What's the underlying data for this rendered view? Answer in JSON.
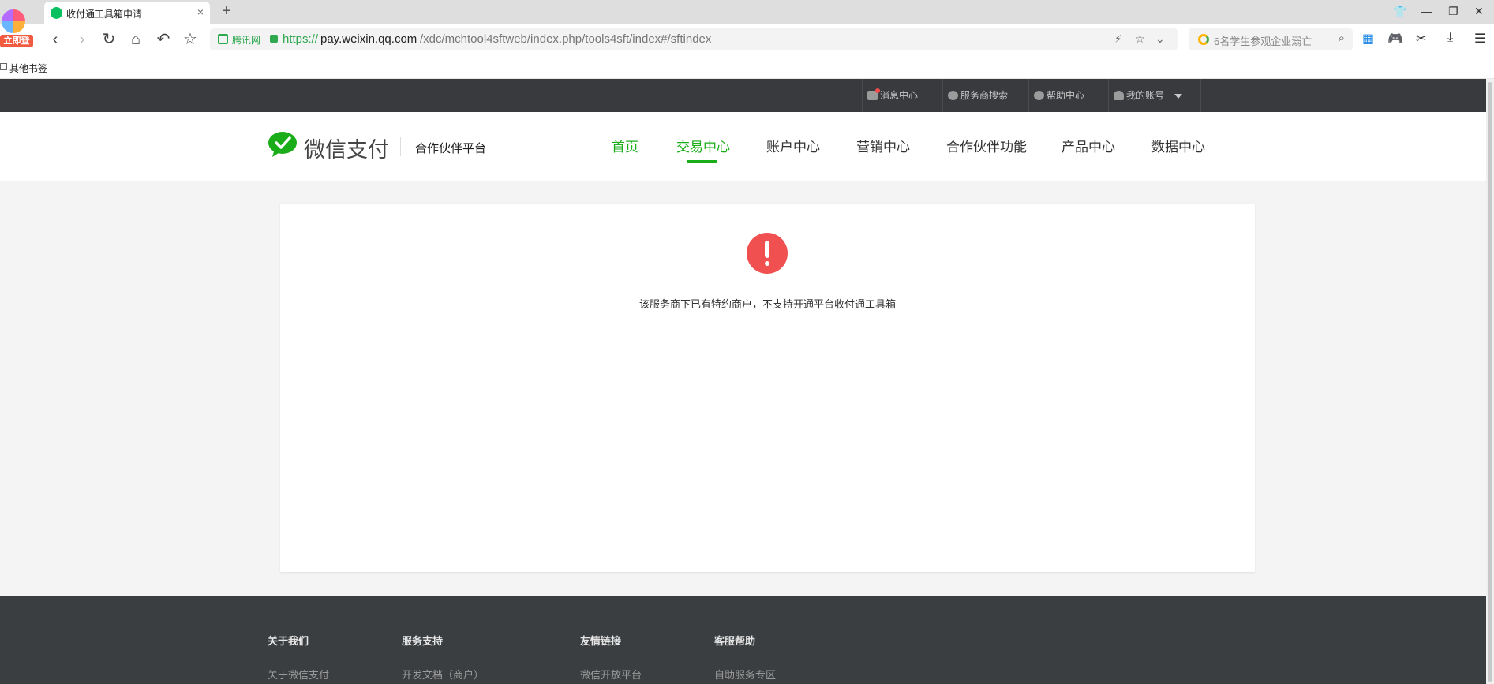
{
  "browser": {
    "profile_badge": "立即登录",
    "tab_title": "收付通工具箱申请",
    "tab_close": "×",
    "new_tab": "+",
    "url": {
      "site_label": "腾讯网",
      "protocol": "https://",
      "host": "pay.weixin.qq.com",
      "path": "/xdc/mchtool4sftweb/index.php/tools4sft/index#/sftindex"
    },
    "search_placeholder": "6名学生参观企业溺亡",
    "bookmark_folder": "其他书签"
  },
  "topbar": {
    "items": [
      {
        "label": "消息中心"
      },
      {
        "label": "服务商搜索"
      },
      {
        "label": "帮助中心"
      },
      {
        "label": "我的账号"
      }
    ]
  },
  "header": {
    "brand_name": "微信支付",
    "brand_sub": "合作伙伴平台",
    "nav": [
      {
        "label": "首页",
        "active": false
      },
      {
        "label": "交易中心",
        "active": true
      },
      {
        "label": "账户中心",
        "active": false
      },
      {
        "label": "营销中心",
        "active": false
      },
      {
        "label": "合作伙伴功能",
        "active": false
      },
      {
        "label": "产品中心",
        "active": false
      },
      {
        "label": "数据中心",
        "active": false
      }
    ],
    "accent_color": "#1aad19"
  },
  "main": {
    "alert_icon": "exclamation-icon",
    "alert_color": "#f05050",
    "message": "该服务商下已有特约商户，不支持开通平台收付通工具箱"
  },
  "footer": {
    "columns": [
      {
        "heading": "关于我们",
        "link": "关于微信支付"
      },
      {
        "heading": "服务支持",
        "link": "开发文档（商户）"
      },
      {
        "heading": "友情链接",
        "link": "微信开放平台"
      },
      {
        "heading": "客服帮助",
        "link": "自助服务专区"
      }
    ]
  }
}
